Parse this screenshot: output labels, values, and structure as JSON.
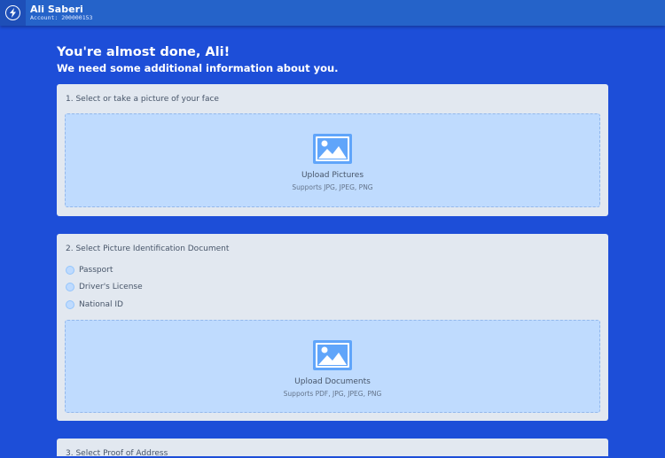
{
  "header": {
    "user_name": "Ali Saberi",
    "account_line": "Account: 200000153"
  },
  "intro": {
    "title": "You're almost done, Ali!",
    "subtitle": "We need some additional information about you."
  },
  "section_face": {
    "title": "1. Select or take a picture of your face",
    "upload_title": "Upload Pictures",
    "upload_hint": "Supports JPG, JPEG, PNG"
  },
  "section_id": {
    "title": "2. Select Picture Identification Document",
    "options": [
      "Passport",
      "Driver's License",
      "National ID"
    ],
    "upload_title": "Upload Documents",
    "upload_hint": "Supports PDF, JPG, JPEG, PNG"
  },
  "section_address": {
    "title": "3. Select Proof of Address"
  },
  "colors": {
    "background": "#1d4ed8",
    "topbar": "#2563c9",
    "card": "#e2e8f0",
    "dropzone": "#bfdbfe",
    "icon": "#60a5fa"
  }
}
